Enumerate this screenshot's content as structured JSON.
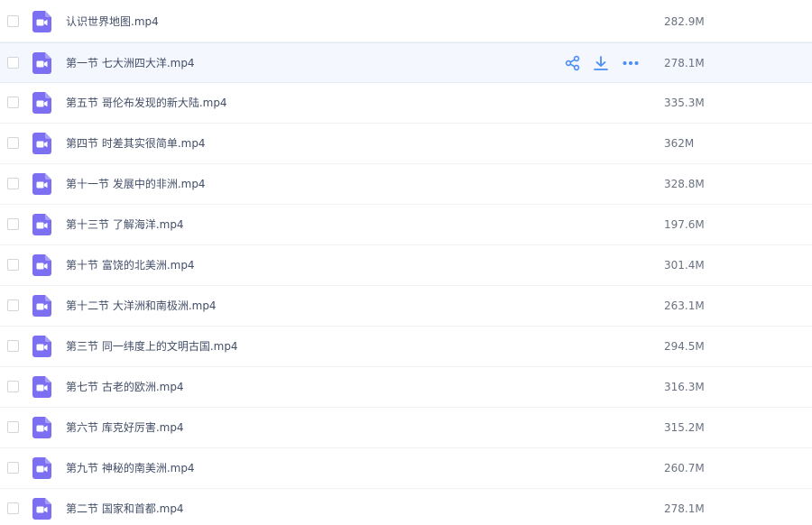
{
  "files": [
    {
      "name": "认识世界地图.mp4",
      "size": "282.9M"
    },
    {
      "name": "第一节 七大洲四大洋.mp4",
      "size": "278.1M",
      "hovered": true
    },
    {
      "name": "第五节 哥伦布发现的新大陆.mp4",
      "size": "335.3M"
    },
    {
      "name": "第四节 时差其实很简单.mp4",
      "size": "362M"
    },
    {
      "name": "第十一节 发展中的非洲.mp4",
      "size": "328.8M"
    },
    {
      "name": "第十三节 了解海洋.mp4",
      "size": "197.6M"
    },
    {
      "name": "第十节 富饶的北美洲.mp4",
      "size": "301.4M"
    },
    {
      "name": "第十二节 大洋洲和南极洲.mp4",
      "size": "263.1M"
    },
    {
      "name": "第三节 同一纬度上的文明古国.mp4",
      "size": "294.5M"
    },
    {
      "name": "第七节 古老的欧洲.mp4",
      "size": "316.3M"
    },
    {
      "name": "第六节 库克好厉害.mp4",
      "size": "315.2M"
    },
    {
      "name": "第九节 神秘的南美洲.mp4",
      "size": "260.7M"
    },
    {
      "name": "第二节 国家和首都.mp4",
      "size": "278.1M"
    }
  ],
  "icons": {
    "file": "video-file-icon",
    "share": "share-icon",
    "download": "download-icon",
    "more": "more-icon"
  },
  "colors": {
    "file_icon": "#7c6ff1",
    "action_icon": "#4a8cf7",
    "hover_bg": "#f4f7fd"
  }
}
